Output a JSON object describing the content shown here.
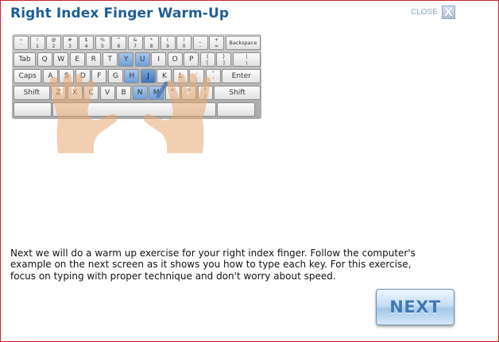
{
  "header": {
    "title": "Right Index Finger Warm-Up",
    "close_label": "CLOSE",
    "close_glyph": "X"
  },
  "keyboard": {
    "rows": [
      [
        {
          "t": "~",
          "b": "`"
        },
        {
          "t": "!",
          "b": "1"
        },
        {
          "t": "@",
          "b": "2"
        },
        {
          "t": "#",
          "b": "3"
        },
        {
          "t": "$",
          "b": "4"
        },
        {
          "t": "%",
          "b": "5"
        },
        {
          "t": "^",
          "b": "6"
        },
        {
          "t": "&",
          "b": "7"
        },
        {
          "t": "*",
          "b": "8"
        },
        {
          "t": "(",
          "b": "9"
        },
        {
          "t": ")",
          "b": "0"
        },
        {
          "t": "_",
          "b": "-"
        },
        {
          "t": "+",
          "b": "="
        },
        {
          "l": "Backspace"
        }
      ],
      [
        {
          "l": "Tab"
        },
        {
          "l": "Q"
        },
        {
          "l": "W"
        },
        {
          "l": "E"
        },
        {
          "l": "R"
        },
        {
          "l": "T"
        },
        {
          "l": "Y",
          "h": 1
        },
        {
          "l": "U",
          "h": 1
        },
        {
          "l": "I"
        },
        {
          "l": "O"
        },
        {
          "l": "P"
        },
        {
          "t": "{",
          "b": "["
        },
        {
          "t": "}",
          "b": "]"
        },
        {
          "t": "|",
          "b": "\\"
        }
      ],
      [
        {
          "l": "Caps"
        },
        {
          "l": "A"
        },
        {
          "l": "S"
        },
        {
          "l": "D"
        },
        {
          "l": "F"
        },
        {
          "l": "G"
        },
        {
          "l": "H",
          "h": 1
        },
        {
          "l": "J",
          "h": 2
        },
        {
          "l": "K"
        },
        {
          "l": "L"
        },
        {
          "t": ":",
          "b": ";"
        },
        {
          "t": "\"",
          "b": "'"
        },
        {
          "l": "Enter"
        }
      ],
      [
        {
          "l": "Shift"
        },
        {
          "l": "Z"
        },
        {
          "l": "X"
        },
        {
          "l": "C"
        },
        {
          "l": "V"
        },
        {
          "l": "B"
        },
        {
          "l": "N",
          "h": 1
        },
        {
          "l": "M",
          "h": 1
        },
        {
          "t": "<",
          "b": ","
        },
        {
          "t": ">",
          "b": "."
        },
        {
          "t": "?",
          "b": "/"
        },
        {
          "l": "Shift"
        }
      ],
      [
        {
          "l": ""
        },
        {
          "l": ""
        },
        {
          "l": ""
        }
      ]
    ],
    "highlighted_keys": [
      "Y",
      "U",
      "H",
      "J",
      "N",
      "M"
    ]
  },
  "instructions": {
    "text": "Next we will do a warm up exercise for your right index finger. Follow the computer's example on the next screen as it shows you how to type each key. For this exercise, focus on typing with proper technique and don't worry about speed."
  },
  "footer": {
    "next_label": "NEXT"
  }
}
